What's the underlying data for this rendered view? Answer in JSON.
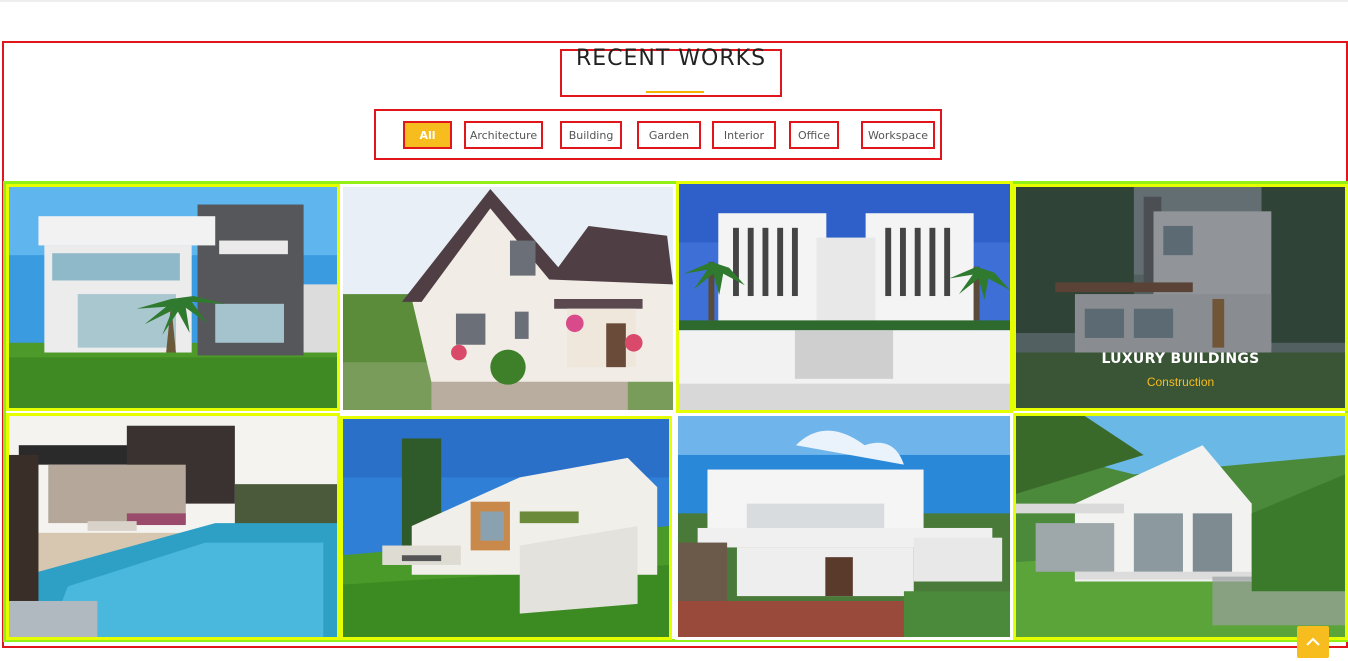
{
  "section": {
    "title": "RECENT WORKS"
  },
  "filters": [
    {
      "label": "All",
      "active": true
    },
    {
      "label": "Architecture",
      "active": false
    },
    {
      "label": "Building",
      "active": false
    },
    {
      "label": "Garden",
      "active": false
    },
    {
      "label": "Interior",
      "active": false
    },
    {
      "label": "Office",
      "active": false
    },
    {
      "label": "Workspace",
      "active": false
    }
  ],
  "featured": {
    "title": "LUXURY BUILDINGS",
    "category": "Construction"
  },
  "colors": {
    "accent": "#f7bd1e",
    "frame_red": "#e0161c",
    "frame_yellow": "#e6ff00",
    "frame_green": "#93f016"
  },
  "icons": {
    "scroll_top": "chevron-up-icon"
  }
}
